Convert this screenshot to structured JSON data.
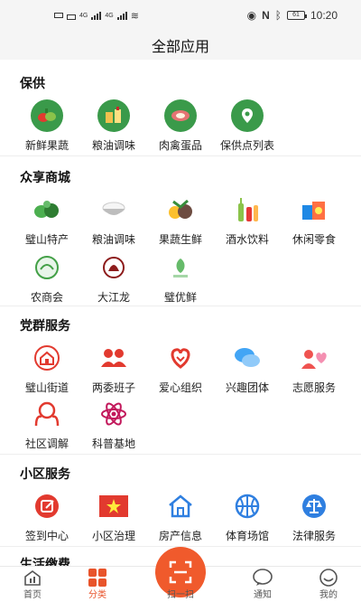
{
  "status": {
    "time": "10:20",
    "net1": "4G",
    "net2": "4G",
    "battery": "61"
  },
  "header": {
    "title": "全部应用"
  },
  "sections": [
    {
      "title": "保供",
      "items": [
        "新鲜果蔬",
        "粮油调味",
        "肉禽蛋品",
        "保供点列表"
      ]
    },
    {
      "title": "众享商城",
      "items": [
        "璧山特产",
        "粮油调味",
        "果蔬生鲜",
        "酒水饮料",
        "休闲零食",
        "农商会",
        "大江龙",
        "璧优鲜"
      ]
    },
    {
      "title": "党群服务",
      "items": [
        "璧山街道",
        "两委班子",
        "爱心组织",
        "兴趣团体",
        "志愿服务",
        "社区调解",
        "科普基地"
      ]
    },
    {
      "title": "小区服务",
      "items": [
        "签到中心",
        "小区治理",
        "房产信息",
        "体育场馆",
        "法律服务"
      ]
    },
    {
      "title": "生活缴费",
      "items": []
    }
  ],
  "tabbar": {
    "home": "首页",
    "category": "分类",
    "scan": "扫一扫",
    "notice": "通知",
    "mine": "我的"
  },
  "colors": {
    "accent": "#f05a2c",
    "red": "#e23a2f",
    "blue": "#2f7fe0",
    "green": "#3a9a4a"
  }
}
